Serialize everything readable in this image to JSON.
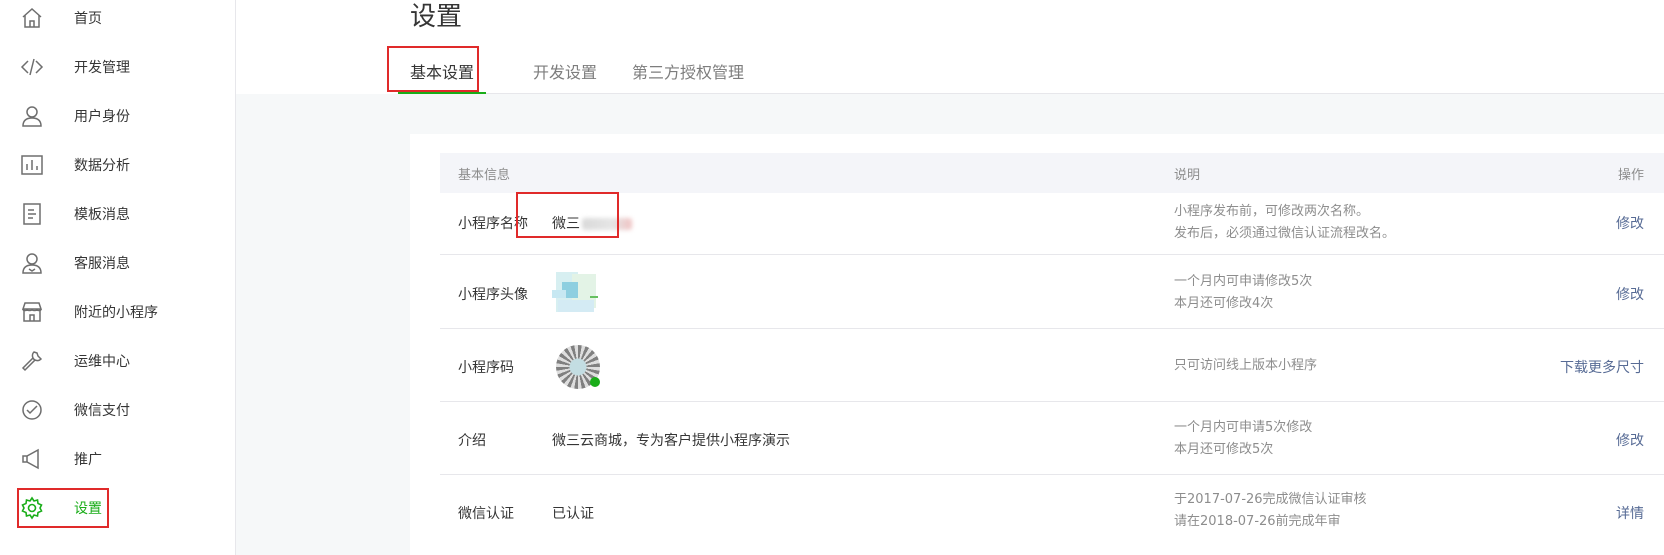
{
  "sidebar": {
    "items": [
      {
        "label": "首页",
        "icon": "home-icon"
      },
      {
        "label": "开发管理",
        "icon": "code-icon"
      },
      {
        "label": "用户身份",
        "icon": "user-icon"
      },
      {
        "label": "数据分析",
        "icon": "bar-chart-icon"
      },
      {
        "label": "模板消息",
        "icon": "document-icon"
      },
      {
        "label": "客服消息",
        "icon": "customer-service-icon"
      },
      {
        "label": "附近的小程序",
        "icon": "store-icon"
      },
      {
        "label": "运维中心",
        "icon": "wrench-icon"
      },
      {
        "label": "微信支付",
        "icon": "payment-icon"
      },
      {
        "label": "推广",
        "icon": "megaphone-icon"
      },
      {
        "label": "设置",
        "icon": "gear-icon"
      }
    ],
    "active_index": 10
  },
  "page": {
    "title": "设置"
  },
  "tabs": [
    {
      "label": "基本设置",
      "active": true
    },
    {
      "label": "开发设置",
      "active": false
    },
    {
      "label": "第三方授权管理",
      "active": false
    }
  ],
  "table": {
    "headers": {
      "info": "基本信息",
      "desc": "说明",
      "action": "操作"
    },
    "rows": [
      {
        "label": "小程序名称",
        "value": "微三",
        "desc": [
          "小程序发布前，可修改两次名称。",
          "发布后，必须通过微信认证流程改名。"
        ],
        "action": "修改"
      },
      {
        "label": "小程序头像",
        "value": "",
        "desc": [
          "一个月内可申请修改5次",
          "本月还可修改4次"
        ],
        "action": "修改"
      },
      {
        "label": "小程序码",
        "value": "",
        "desc": [
          "只可访问线上版本小程序"
        ],
        "action": "下载更多尺寸"
      },
      {
        "label": "介绍",
        "value": "微三云商城，专为客户提供小程序演示",
        "desc": [
          "一个月内可申请5次修改",
          "本月还可修改5次"
        ],
        "action": "修改"
      },
      {
        "label": "微信认证",
        "value": "已认证",
        "desc": [
          "于2017-07-26完成微信认证审核",
          "请在2018-07-26前完成年审"
        ],
        "action": "详情"
      }
    ]
  },
  "colors": {
    "accent_green": "#1aad19",
    "link_blue": "#576b95",
    "highlight_red": "#e02a2a"
  }
}
